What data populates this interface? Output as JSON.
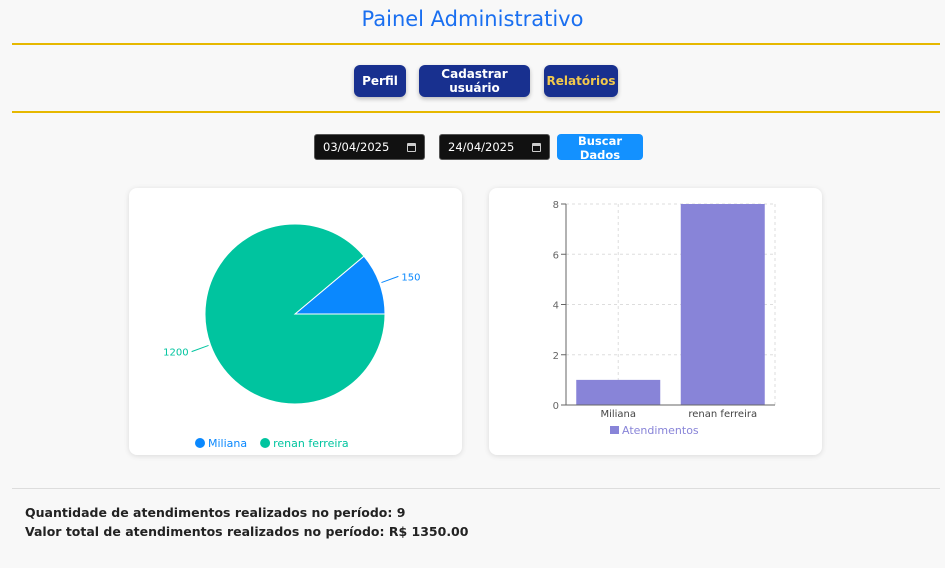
{
  "header": {
    "title": "Painel Administrativo"
  },
  "nav": {
    "perfil": "Perfil",
    "cadastrar": "Cadastrar usuário",
    "relatorios": "Relatórios"
  },
  "filters": {
    "start_date": "03/04/2025",
    "end_date": "24/04/2025",
    "search_label": "Buscar Dados"
  },
  "colors": {
    "blue": "#0a88fe",
    "green": "#00c49f",
    "bar": "#8884d8",
    "gold": "#e6b800",
    "navy": "#18308f"
  },
  "chart_data": [
    {
      "type": "pie",
      "categories": [
        "Miliana",
        "renan ferreira"
      ],
      "values": [
        150,
        1200
      ],
      "labels": [
        "150",
        "1200"
      ],
      "legend": "bottom"
    },
    {
      "type": "bar",
      "categories": [
        "Miliana",
        "renan ferreira"
      ],
      "series": [
        {
          "name": "Atendimentos",
          "values": [
            1,
            8
          ]
        }
      ],
      "ylim": [
        0,
        8
      ],
      "yticks": [
        "0",
        "2",
        "4",
        "6",
        "8"
      ],
      "grid": true,
      "legend": "bottom"
    }
  ],
  "summary": {
    "count_line": "Quantidade de atendimentos realizados no período: 9",
    "total_line": "Valor total de atendimentos realizados no período: R$ 1350.00"
  }
}
